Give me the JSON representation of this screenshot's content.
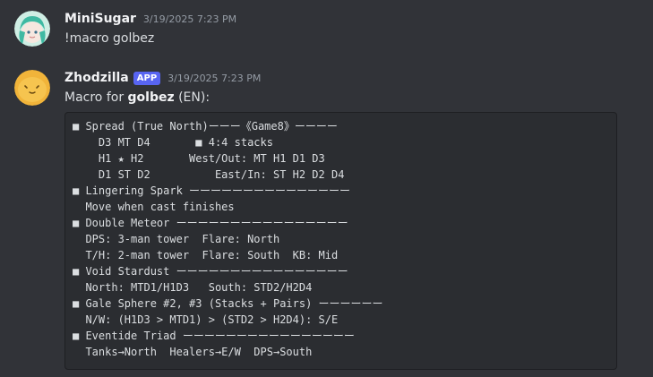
{
  "messages": [
    {
      "username": "MiniSugar",
      "timestamp": "3/19/2025 7:23 PM",
      "text": "!macro golbez"
    },
    {
      "username": "Zhodzilla",
      "badge": "APP",
      "timestamp": "3/19/2025 7:23 PM",
      "text_prefix": "Macro for ",
      "text_bold": "golbez",
      "text_suffix": " (EN):",
      "code_lines": [
        "■ Spread (True North)ーーー《Game8》ーーーー",
        "    D3 MT D4       ■ 4:4 stacks",
        "    H1 ★ H2       West/Out: MT H1 D1 D3",
        "    D1 ST D2          East/In: ST H2 D2 D4",
        "■ Lingering Spark ーーーーーーーーーーーーーーー",
        "  Move when cast finishes",
        "■ Double Meteor ーーーーーーーーーーーーーーーー",
        "  DPS: 3-man tower  Flare: North",
        "  T/H: 2-man tower  Flare: South  KB: Mid",
        "■ Void Stardust ーーーーーーーーーーーーーーーー",
        "  North: MTD1/H1D3   South: STD2/H2D4",
        "■ Gale Sphere #2, #3 (Stacks + Pairs) ーーーーーー",
        "  N/W: (H1D3 > MTD1) > (STD2 > H2D4): S/E",
        "■ Eventide Triad ーーーーーーーーーーーーーーーー",
        "  Tanks→North  Healers→E/W  DPS→South"
      ]
    }
  ],
  "colors": {
    "background": "#313338",
    "codeblock": "#2b2d31",
    "badge": "#5865f2"
  }
}
